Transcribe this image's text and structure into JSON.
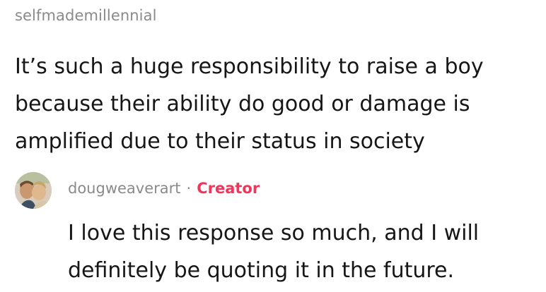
{
  "comment": {
    "username": "selfmademillennial",
    "text": "It’s such a huge responsibility to raise a boy because their ability do good or damage is amplified due to their status in society"
  },
  "reply": {
    "username": "dougweaverart",
    "separator": "·",
    "badge": "Creator",
    "text": "I love this response so much, and I will definitely be quoting it in the future.",
    "avatar_icon": "profile-photo"
  },
  "colors": {
    "username": "#8a8a8a",
    "text": "#161616",
    "creator_badge": "#f2355a"
  }
}
